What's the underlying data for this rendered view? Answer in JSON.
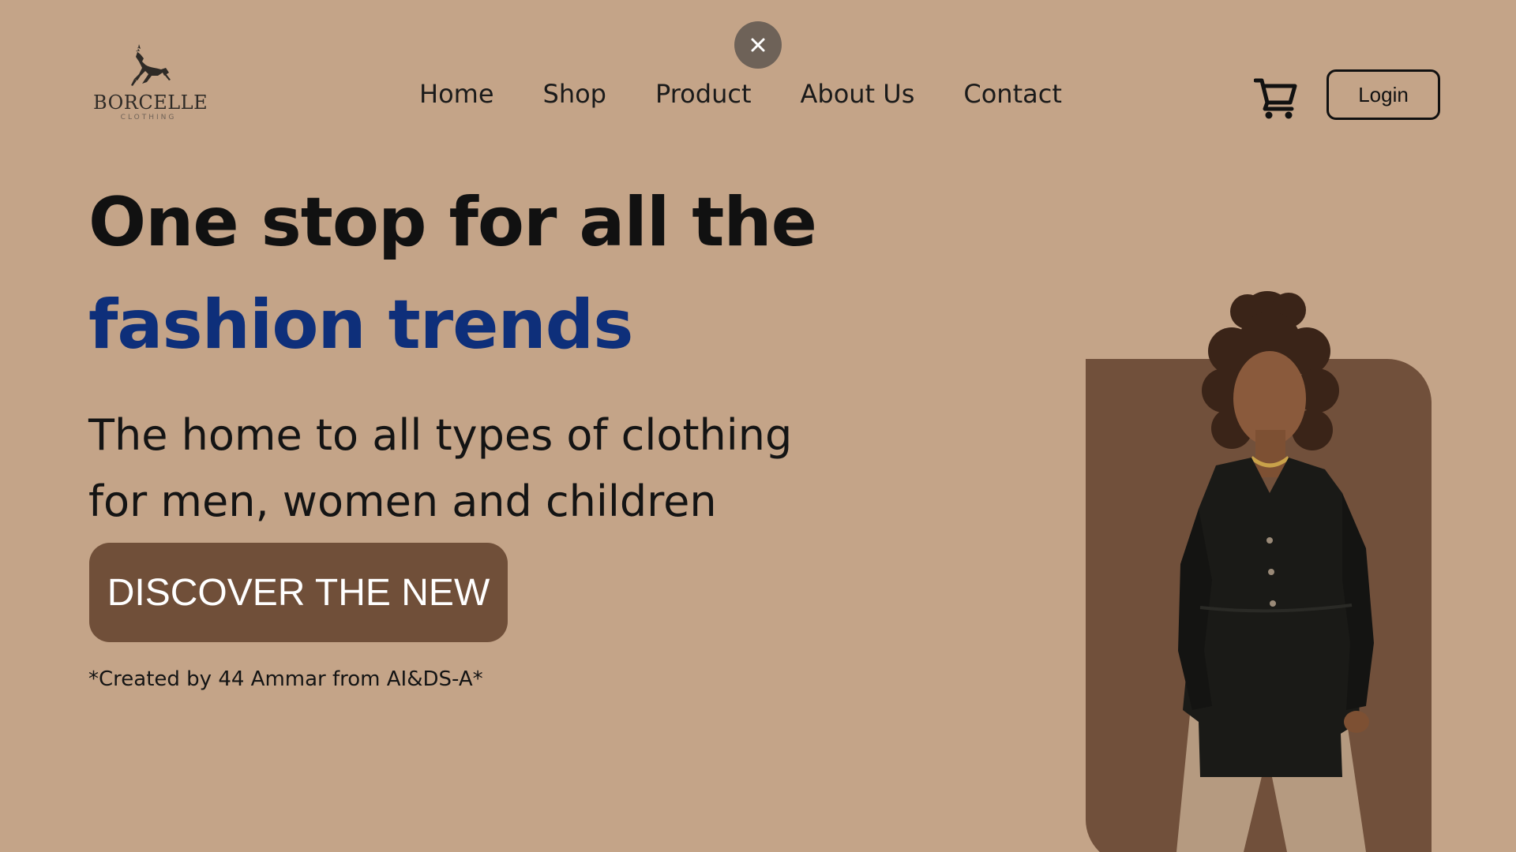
{
  "header": {
    "close_label": "✕",
    "logo": {
      "name": "BORCELLE",
      "subtitle": "CLOTHING"
    },
    "nav": [
      {
        "label": "Home"
      },
      {
        "label": "Shop"
      },
      {
        "label": "Product"
      },
      {
        "label": "About Us"
      },
      {
        "label": "Contact"
      }
    ],
    "cart_icon": "shopping-cart-icon",
    "login_label": "Login"
  },
  "hero": {
    "title_line1": "One stop for all the",
    "title_line2": "fashion trends",
    "subtitle_line1": "The home to all types of clothing",
    "subtitle_line2": "for men, women and children",
    "cta_label": "DISCOVER THE NEW",
    "credit": "*Created by 44 Ammar from AI&DS-A*"
  },
  "colors": {
    "background": "#c4a488",
    "accent_blue": "#0e2f7a",
    "cta_brown": "#704f39",
    "card_brown": "#71503b"
  }
}
